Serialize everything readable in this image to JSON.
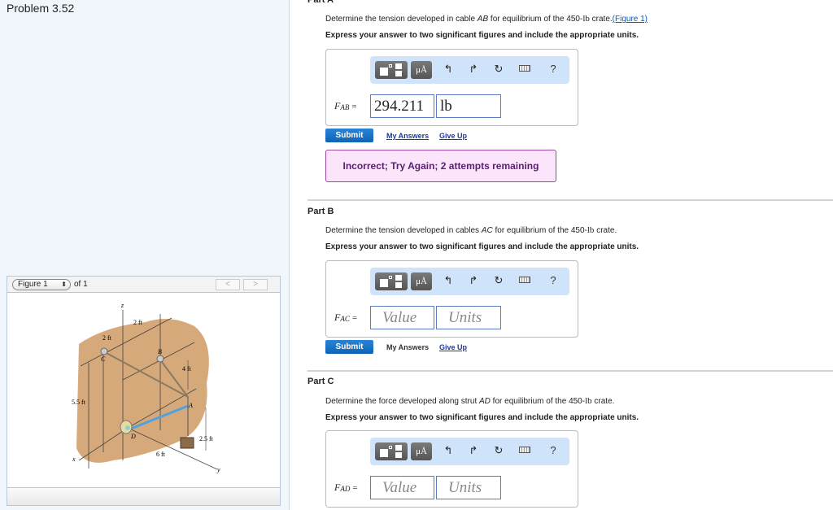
{
  "problem": {
    "title": "Problem 3.52"
  },
  "figure": {
    "selector_value": "Figure 1",
    "of_label": "of 1",
    "prev_label": "<",
    "next_label": ">",
    "labels": {
      "z": "z",
      "x": "x",
      "y": "y",
      "A": "A",
      "B": "B",
      "C": "C",
      "D": "D",
      "dim_2ft_a": "2 ft",
      "dim_2ft_b": "2 ft",
      "dim_4ft": "4 ft",
      "dim_5_5ft": "5.5 ft",
      "dim_2_5ft": "2.5 ft",
      "dim_6ft": "6 ft"
    }
  },
  "toolbar": {
    "template_icon": "templates-icon",
    "units_label": "μÅ",
    "undo_glyph": "↰",
    "redo_glyph": "↱",
    "reset_glyph": "↻",
    "help_label": "?"
  },
  "parts": [
    {
      "title": "Part A",
      "desc_pre": "Determine the tension developed in cable ",
      "desc_var": "AB",
      "desc_mid": " for equilibrium of the 450-",
      "desc_unit": "lb",
      "desc_post": " crate.",
      "figure_link": "(Figure 1)",
      "instruction": "Express your answer to two significant figures and include the appropriate units.",
      "var_main": "F",
      "var_sub": "AB",
      "equals": "=",
      "value": "294.211",
      "units": "lb",
      "submit_label": "Submit",
      "my_answers_label": "My Answers",
      "give_up_label": "Give Up",
      "feedback": "Incorrect; Try Again; 2 attempts remaining"
    },
    {
      "title": "Part B",
      "desc_pre": "Determine the tension developed in cables ",
      "desc_var": "AC",
      "desc_mid": " for equilibrium of the 450-",
      "desc_unit": "lb",
      "desc_post": " crate.",
      "instruction": "Express your answer to two significant figures and include the appropriate units.",
      "var_main": "F",
      "var_sub": "AC",
      "equals": "=",
      "value_placeholder": "Value",
      "units_placeholder": "Units",
      "submit_label": "Submit",
      "my_answers_label": "My Answers",
      "give_up_label": "Give Up"
    },
    {
      "title": "Part C",
      "desc_pre": "Determine the force developed along strut ",
      "desc_var": "AD",
      "desc_mid": " for equilibrium of the 450-",
      "desc_unit": "lb",
      "desc_post": " crate.",
      "instruction": "Express your answer to two significant figures and include the appropriate units.",
      "var_main": "F",
      "var_sub": "AD",
      "equals": "=",
      "value_placeholder": "Value",
      "units_placeholder": "Units"
    }
  ]
}
